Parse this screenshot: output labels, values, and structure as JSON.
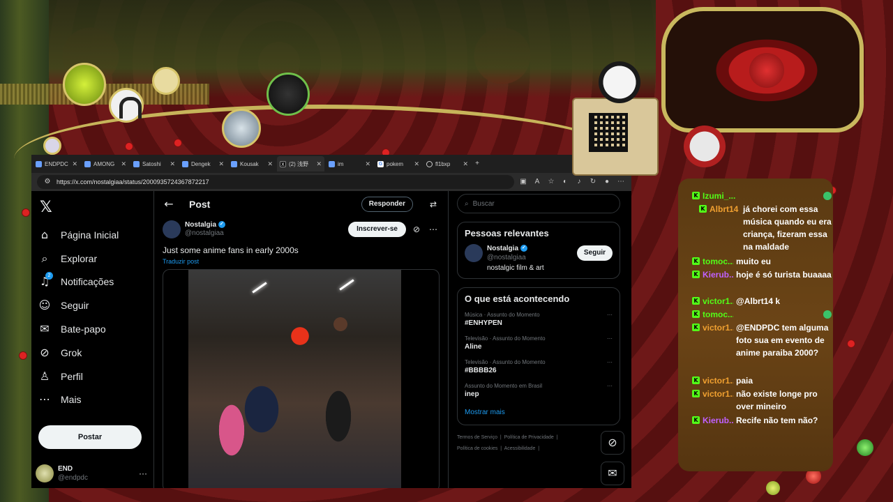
{
  "colors": {
    "accent_blue": "#1d9bf0",
    "bg_black": "#000000",
    "border": "#2f3336",
    "kick_green": "#53fc18",
    "chat_bg": "#6b4416"
  },
  "browser": {
    "tabs": [
      {
        "label": "ENDPDC",
        "icon": "tab-favicon"
      },
      {
        "label": "AMONG",
        "icon": "tab-favicon"
      },
      {
        "label": "Satoshi",
        "icon": "tab-favicon"
      },
      {
        "label": "Dengek",
        "icon": "tab-favicon"
      },
      {
        "label": "Kousak",
        "icon": "tab-favicon"
      },
      {
        "label": "(2) 浅野",
        "icon": "x-favicon"
      },
      {
        "label": "im",
        "icon": "tab-favicon"
      },
      {
        "label": "pokem",
        "icon": "google-favicon"
      },
      {
        "label": "fl1bxp",
        "icon": "globe-favicon"
      }
    ],
    "new_tab_label": "+",
    "url": "https://x.com/nostalgiaa/status/2000935724367872217"
  },
  "leftnav": {
    "logo": "𝕏",
    "items": [
      {
        "label": "Página Inicial",
        "icon": "home-icon"
      },
      {
        "label": "Explorar",
        "icon": "search-icon"
      },
      {
        "label": "Notificações",
        "icon": "bell-icon"
      },
      {
        "label": "Seguir",
        "icon": "person-add-icon"
      },
      {
        "label": "Bate-papo",
        "icon": "mail-icon"
      },
      {
        "label": "Grok",
        "icon": "grok-icon"
      },
      {
        "label": "Perfil",
        "icon": "person-icon"
      },
      {
        "label": "Mais",
        "icon": "more-circle-icon"
      }
    ],
    "notification_count": "2",
    "post_button": "Postar",
    "account": {
      "name": "END",
      "handle": "@endpdc",
      "more": "···"
    }
  },
  "center": {
    "header_title": "Post",
    "reply_button": "Responder",
    "author": {
      "name": "Nostalgia",
      "handle": "@nostalgiaa"
    },
    "subscribe_button": "Inscrever-se",
    "tweet_text": "Just some anime fans in early 2000s",
    "translate_link": "Traduzir post"
  },
  "rightcol": {
    "search_placeholder": "Buscar",
    "relevant": {
      "title": "Pessoas relevantes",
      "name": "Nostalgia",
      "handle": "@nostalgiaa",
      "bio": "nostalgic film & art",
      "follow_button": "Seguir"
    },
    "trending": {
      "title": "O que está acontecendo",
      "items": [
        {
          "context": "Música · Assunto do Momento",
          "name": "#ENHYPEN"
        },
        {
          "context": "Televisão · Assunto do Momento",
          "name": "Aline"
        },
        {
          "context": "Televisão · Assunto do Momento",
          "name": "#BBBB26"
        },
        {
          "context": "Assunto do Momento em Brasil",
          "name": "inep"
        }
      ],
      "show_more": "Mostrar mais"
    },
    "footer": {
      "terms": "Termos de Serviço",
      "privacy": "Política de Privacidade",
      "cookies": "Política de cookies",
      "accessibility": "Acessibilidade"
    }
  },
  "chat": {
    "messages": [
      {
        "user": "Izumi_...",
        "color": "#53fc18",
        "msg": "",
        "emoji": "green-emoji"
      },
      {
        "user": "Albrt14",
        "color": "#f0a030",
        "msg": "já chorei com essa música quando eu era criança, fizeram essa na maldade"
      },
      {
        "user": "tomoc...",
        "color": "#53fc18",
        "msg": "muito eu"
      },
      {
        "user": "Kierub...",
        "color": "#c060ff",
        "msg": "hoje é só turista buaaaa"
      },
      {
        "user": "victor1...",
        "color": "#53fc18",
        "msg": "@Albrt14 k"
      },
      {
        "user": "tomoc...",
        "color": "#53fc18",
        "msg": "",
        "emoji": "green-emoji"
      },
      {
        "user": "victor1...",
        "color": "#f0a030",
        "msg": "@ENDPDC tem alguma foto sua em evento de anime paraiba 2000?"
      },
      {
        "user": "victor1...",
        "color": "#f0a030",
        "msg": "paia"
      },
      {
        "user": "victor1...",
        "color": "#f0a030",
        "msg": "não existe longe pro over mineiro"
      },
      {
        "user": "Kierub...",
        "color": "#c060ff",
        "msg": "Recife não tem não?"
      }
    ]
  }
}
